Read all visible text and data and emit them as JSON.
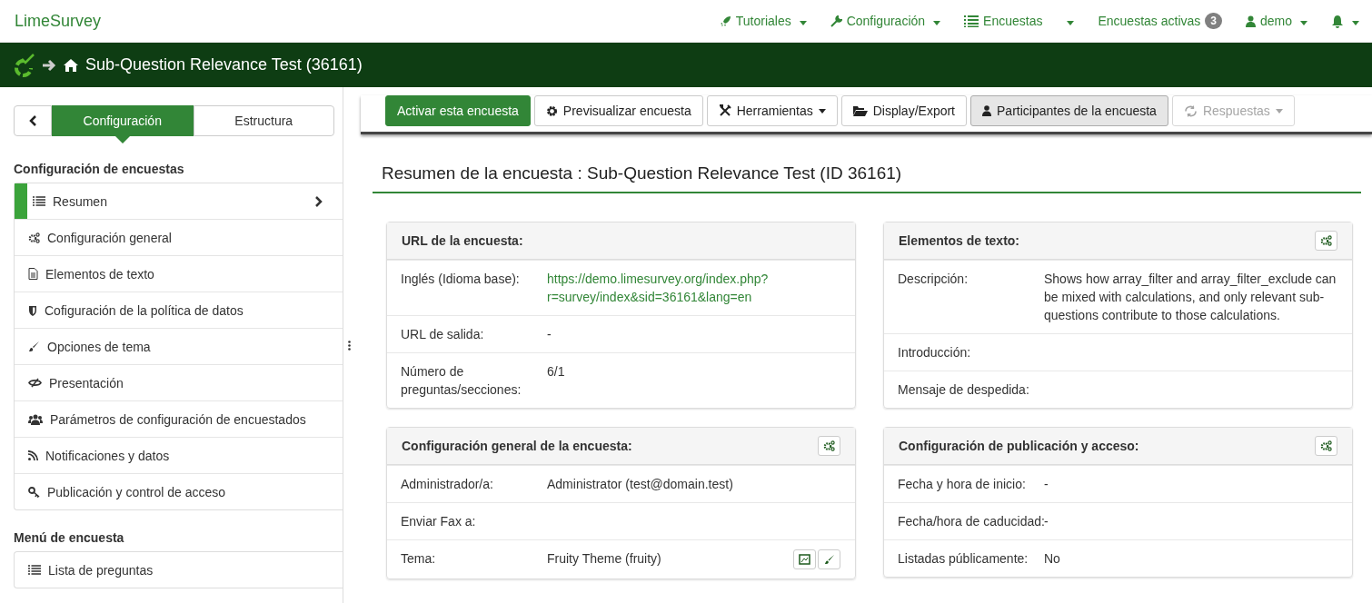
{
  "navbar": {
    "brand": "LimeSurvey",
    "items": [
      {
        "label": "Tutoriales",
        "caret": true
      },
      {
        "label": "Configuración",
        "caret": true
      },
      {
        "label": "Encuestas",
        "caret": true
      },
      {
        "label": "Encuestas activas",
        "badge": "3",
        "caret": false
      },
      {
        "label": "demo",
        "caret": true
      },
      {
        "caret": true
      }
    ]
  },
  "title_bar": {
    "title": "Sub-Question Relevance Test (36161)"
  },
  "sidebar": {
    "tabs": [
      {
        "label": "Configuración",
        "selected": true
      },
      {
        "label": "Estructura",
        "selected": false
      }
    ],
    "sections": [
      {
        "heading": "Configuración de encuestas",
        "items": [
          {
            "label": "Resumen",
            "selected": true
          },
          {
            "label": "Configuración general",
            "selected": false
          },
          {
            "label": "Elementos de texto",
            "selected": false
          },
          {
            "label": "Cofiguración de la política de datos",
            "selected": false
          },
          {
            "label": "Opciones de tema",
            "selected": false
          },
          {
            "label": "Presentación",
            "selected": false
          },
          {
            "label": "Parámetros de configuración de encuestados",
            "selected": false
          },
          {
            "label": "Notificaciones y datos",
            "selected": false
          },
          {
            "label": "Publicación y control de acceso",
            "selected": false
          }
        ]
      },
      {
        "heading": "Menú de encuesta",
        "items": [
          {
            "label": "Lista de preguntas",
            "selected": false
          }
        ]
      }
    ]
  },
  "toolbar": {
    "buttons": [
      {
        "label": "Activar esta encuesta",
        "kind": "primary",
        "caret": false,
        "disabled": false
      },
      {
        "label": "Previsualizar encuesta",
        "kind": "default",
        "caret": false,
        "disabled": false
      },
      {
        "label": "Herramientas",
        "kind": "default",
        "caret": true,
        "disabled": false
      },
      {
        "label": "Display/Export",
        "kind": "default",
        "caret": false,
        "disabled": false
      },
      {
        "label": "Participantes de la encuesta",
        "kind": "pressed",
        "caret": false,
        "disabled": false
      },
      {
        "label": "Respuestas",
        "kind": "default",
        "caret": true,
        "disabled": true
      }
    ]
  },
  "summary": {
    "heading": "Resumen de la encuesta : Sub-Question Relevance Test (ID 36161)",
    "cards": [
      {
        "title": "URL de la encuesta:",
        "settings_button": false,
        "rows": [
          {
            "label": "Inglés (Idioma base):",
            "value": "https://demo.limesurvey.org/index.php?r=survey/index&sid=36161&lang=en",
            "kind": "link"
          },
          {
            "label": "URL de salida:",
            "value": "-",
            "kind": "text"
          },
          {
            "label": "Número de preguntas/secciones:",
            "value": "6/1",
            "kind": "text"
          }
        ]
      },
      {
        "title": "Elementos de texto:",
        "settings_button": true,
        "rows": [
          {
            "label": "Descripción:",
            "value": "Shows how array_filter and array_filter_exclude can be mixed with calculations, and only relevant sub-questions contribute to those calculations.",
            "kind": "text"
          },
          {
            "label": "Introducción:",
            "kind": "text"
          },
          {
            "label": "Mensaje de despedida:",
            "kind": "text"
          }
        ]
      },
      {
        "title": "Configuración general de la encuesta:",
        "settings_button": true,
        "rows": [
          {
            "label": "Administrador/a:",
            "value": "Administrator (test@domain.test)",
            "kind": "text"
          },
          {
            "label": "Enviar Fax a:",
            "kind": "text"
          },
          {
            "label": "Tema:",
            "value": "Fruity Theme (fruity)",
            "kind": "theme"
          }
        ]
      },
      {
        "title": "Configuración de publicación y acceso:",
        "settings_button": true,
        "rows": [
          {
            "label": "Fecha y hora de inicio:",
            "value": "-",
            "kind": "text"
          },
          {
            "label": "Fecha/hora de caducidad:",
            "value": "-",
            "kind": "text"
          },
          {
            "label": "Listadas públicamente:",
            "value": "No",
            "kind": "text"
          }
        ]
      }
    ]
  }
}
